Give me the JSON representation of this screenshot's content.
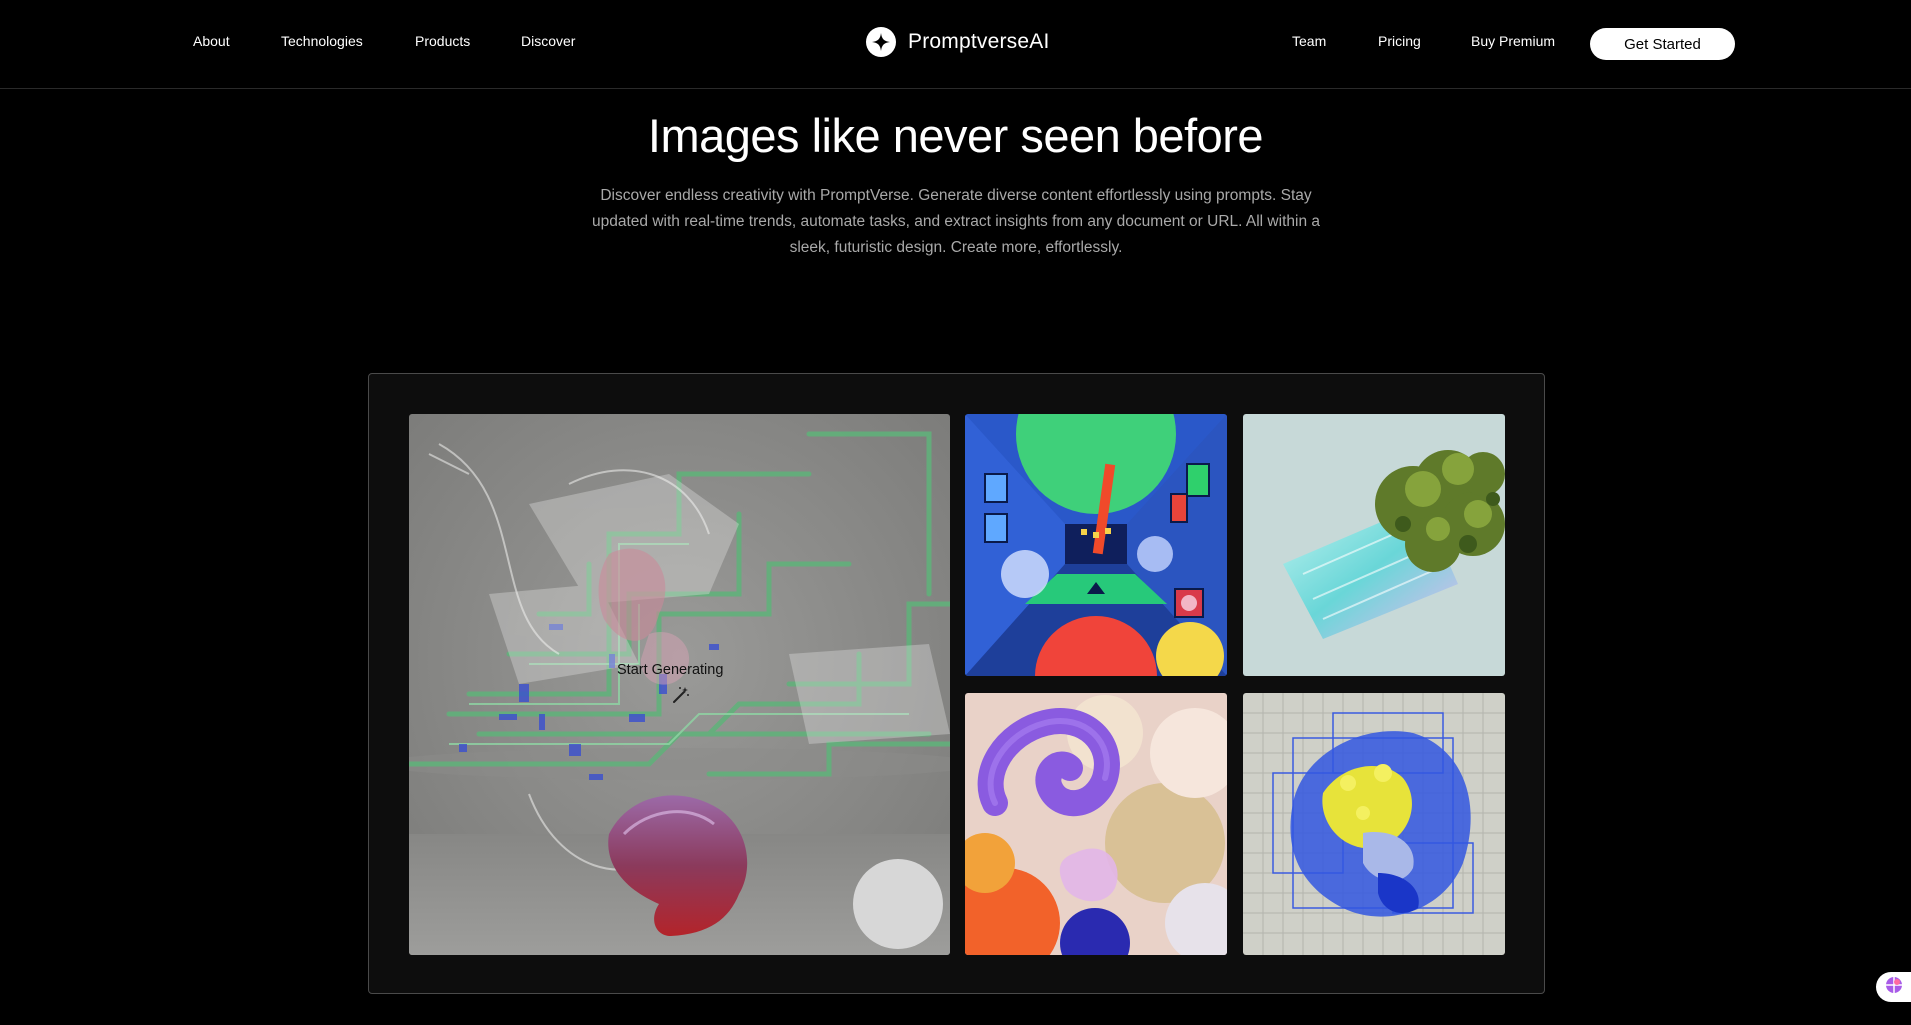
{
  "nav": {
    "left_links": [
      "About",
      "Technologies",
      "Products",
      "Discover"
    ],
    "brand_name": "PromptverseAI",
    "right_links": [
      "Team",
      "Pricing",
      "Buy Premium"
    ],
    "cta_label": "Get Started"
  },
  "hero": {
    "title": "Images like never seen before",
    "description": "Discover endless creativity with PromptVerse. Generate diverse content effortlessly using prompts. Stay updated with real-time trends, automate tasks, and extract insights from any document or URL. All within a sleek, futuristic design. Create more, effortlessly."
  },
  "gallery": {
    "start_label": "Start Generating",
    "tiles": [
      {
        "id": "main",
        "subject": "abstract glass and circuitry sculpture"
      },
      {
        "id": "a",
        "subject": "colorful retro arcade corridor"
      },
      {
        "id": "b",
        "subject": "crystal prism with moss"
      },
      {
        "id": "c",
        "subject": "soft clay spheres and spiral"
      },
      {
        "id": "d",
        "subject": "yellow and blue coral on grid"
      }
    ]
  },
  "icons": {
    "brand": "sparkle-icon",
    "wand": "magic-wand-icon",
    "chat": "chat-widget-icon"
  },
  "colors": {
    "background": "#000000",
    "text": "#ffffff",
    "muted_text": "#a9a9a9",
    "button_bg": "#ffffff",
    "button_text": "#000000"
  }
}
